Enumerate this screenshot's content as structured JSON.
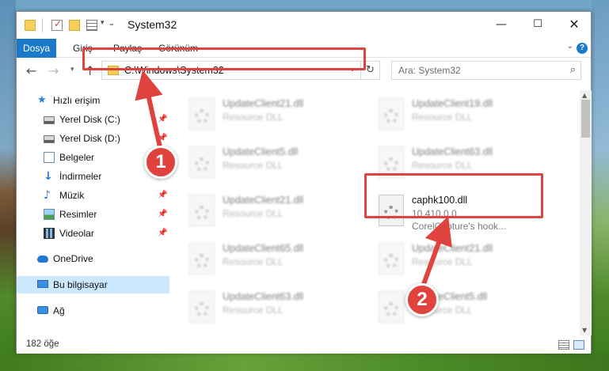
{
  "window": {
    "title": "System32",
    "controls": {
      "minimize": "—",
      "maximize": "☐",
      "close": "✕"
    }
  },
  "ribbon": {
    "tabs": [
      "Dosya",
      "Giriş",
      "Paylaş",
      "Görünüm"
    ],
    "accent": "#1979ca"
  },
  "nav": {
    "address": "C:\\Windows\\System32",
    "search_placeholder": "Ara: System32"
  },
  "sidebar": {
    "items": [
      {
        "label": "Hızlı erişim",
        "icon": "star-icon"
      },
      {
        "label": "Yerel Disk (C:)",
        "icon": "drive-icon",
        "pinned": true
      },
      {
        "label": "Yerel Disk (D:)",
        "icon": "drive-icon",
        "pinned": true
      },
      {
        "label": "Belgeler",
        "icon": "documents-icon",
        "pinned": true
      },
      {
        "label": "İndirmeler",
        "icon": "download-icon",
        "pinned": true
      },
      {
        "label": "Müzik",
        "icon": "music-icon",
        "pinned": true
      },
      {
        "label": "Resimler",
        "icon": "pictures-icon",
        "pinned": true
      },
      {
        "label": "Videolar",
        "icon": "videos-icon",
        "pinned": true
      },
      {
        "label": "OneDrive",
        "icon": "cloud-icon"
      },
      {
        "label": "Bu bilgisayar",
        "icon": "computer-icon",
        "selected": true
      },
      {
        "label": "Ağ",
        "icon": "network-icon"
      }
    ]
  },
  "files": [
    {
      "name": "UpdateClient21.dll",
      "type": "Resource DLL"
    },
    {
      "name": "UpdateClient19.dll",
      "type": "Resource DLL"
    },
    {
      "name": "UpdateClient5.dll",
      "type": "Resource DLL"
    },
    {
      "name": "UpdateClient63.dll",
      "type": "Resource DLL"
    },
    {
      "name": "UpdateClient21.dll",
      "type": "Resource DLL"
    },
    {
      "name": "caphk100.dll",
      "type": "10.410.0.0",
      "description": "CorelCapture's hook..."
    },
    {
      "name": "UpdateClient65.dll",
      "type": "Resource DLL"
    },
    {
      "name": "UpdateClient21.dll",
      "type": "Resource DLL"
    },
    {
      "name": "UpdateClient63.dll",
      "type": "Resource DLL"
    },
    {
      "name": "UpdateClient5.dll",
      "type": "Resource DLL"
    }
  ],
  "status": {
    "item_count": "182 öğe"
  },
  "annotations": {
    "step1": "1",
    "step2": "2",
    "color": "#e0423e"
  }
}
